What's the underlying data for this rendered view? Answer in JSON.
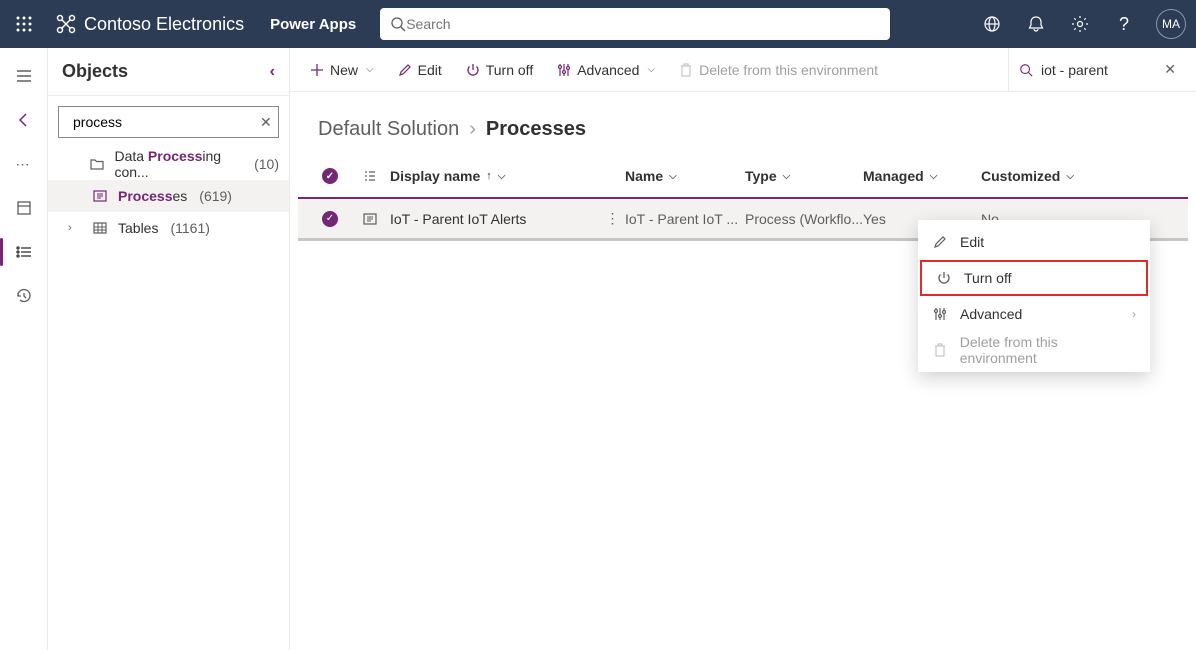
{
  "header": {
    "org": "Contoso Electronics",
    "app": "Power Apps",
    "search_placeholder": "Search",
    "avatar": "MA"
  },
  "panel": {
    "title": "Objects",
    "search_value": "process",
    "tree": {
      "item0_pre": "Data ",
      "item0_hl": "Process",
      "item0_post": "ing con...",
      "item0_count": "(10)",
      "item1_hl": "Process",
      "item1_post": "es",
      "item1_count": "(619)",
      "item2_label": "Tables",
      "item2_count": "(1161)"
    }
  },
  "cmd": {
    "new": "New",
    "edit": "Edit",
    "turnoff": "Turn off",
    "advanced": "Advanced",
    "delete": "Delete from this environment"
  },
  "filter": {
    "value": "iot - parent"
  },
  "crumb": {
    "parent": "Default Solution",
    "current": "Processes"
  },
  "cols": {
    "dn": "Display name",
    "name": "Name",
    "type": "Type",
    "man": "Managed",
    "cus": "Customized"
  },
  "row": {
    "dn": "IoT - Parent IoT Alerts",
    "name": "IoT - Parent IoT ...",
    "type": "Process (Workflo...",
    "man": "Yes",
    "cus": "No"
  },
  "ctx": {
    "edit": "Edit",
    "turnoff": "Turn off",
    "advanced": "Advanced",
    "delete": "Delete from this environment"
  }
}
